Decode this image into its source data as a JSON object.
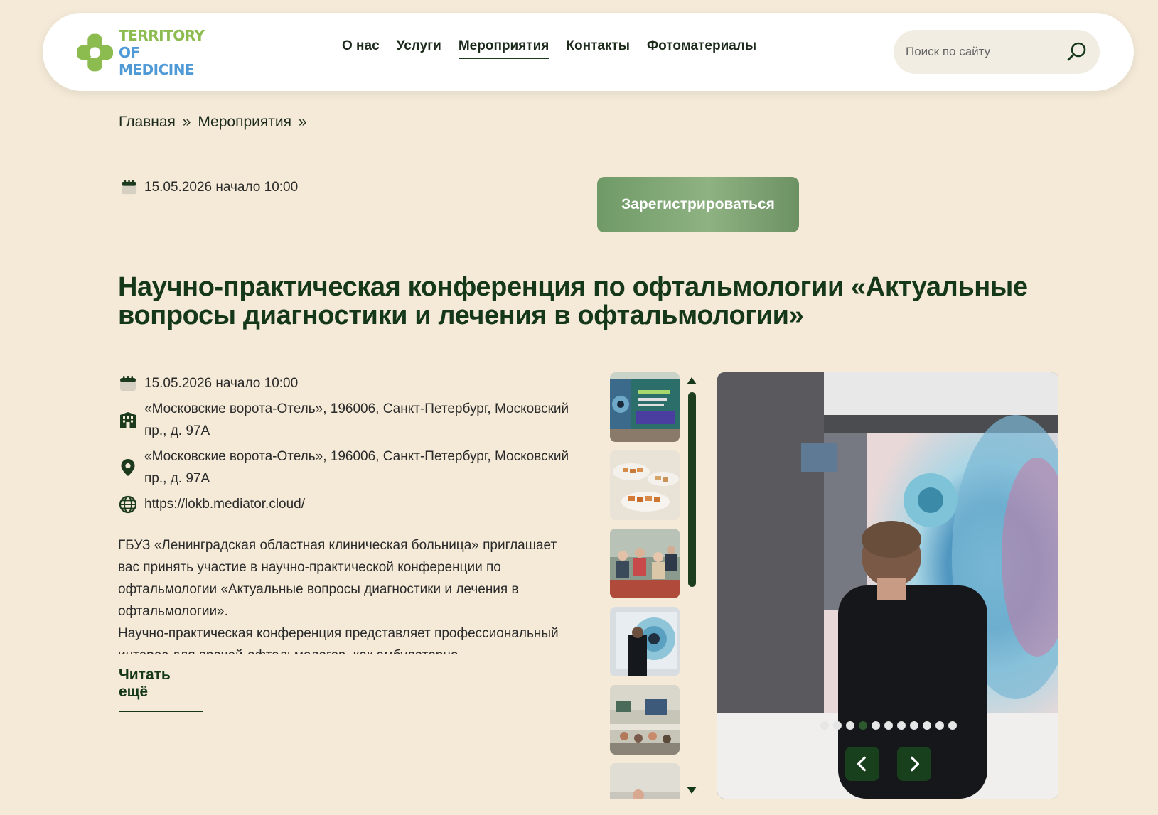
{
  "header": {
    "logo": {
      "line1": "TERRITORY",
      "line2": "OF MEDICINE"
    },
    "nav": [
      {
        "label": "О нас",
        "active": false
      },
      {
        "label": "Услуги",
        "active": false
      },
      {
        "label": "Мероприятия",
        "active": true
      },
      {
        "label": "Контакты",
        "active": false
      },
      {
        "label": "Фотоматериалы",
        "active": false
      }
    ],
    "search": {
      "placeholder": "Поиск по сайту",
      "icon": "search-icon"
    }
  },
  "breadcrumb": {
    "items": [
      "Главная",
      "Мероприятия"
    ],
    "separator": "»"
  },
  "event": {
    "date_line": "15.05.2026 начало 10:00",
    "register_label": "Зарегистрироваться",
    "title": "Научно-практическая конференция по офтальмологии «Актуальные вопросы диагностики и лечения в офтальмологии»",
    "info": {
      "date": "15.05.2026 начало 10:00",
      "venue": "«Московские ворота-Отель», 196006, Санкт-Петербург, Московский пр., д. 97А",
      "address": "«Московские ворота-Отель», 196006, Санкт-Петербург, Московский пр., д. 97А",
      "website": "https://lokb.mediator.cloud/"
    },
    "description": [
      "ГБУЗ «Ленинградская областная клиническая больница» приглашает вас принять участие в научно-практической конференции по офтальмологии «Актуальные вопросы диагностики и лечения в офтальмологии».",
      "Научно-практическая конференция представляет профессиональный интерес для врачей-офтальмологов, как амбулаторно-поликлинической"
    ],
    "read_more": "Читать ещё"
  },
  "gallery": {
    "thumbnails": [
      "conference-banner",
      "buffet-snacks",
      "audience",
      "speaker-screen",
      "conference-hall",
      "presentation"
    ],
    "dots_count": 11,
    "active_dot": 3,
    "prev_icon": "chevron-left-icon",
    "next_icon": "chevron-right-icon"
  },
  "colors": {
    "background": "#f4ead7",
    "primary_dark": "#16381a",
    "button_green": "#7aa270",
    "logo_green": "#8cbb4f",
    "logo_blue": "#4f9ad6"
  }
}
